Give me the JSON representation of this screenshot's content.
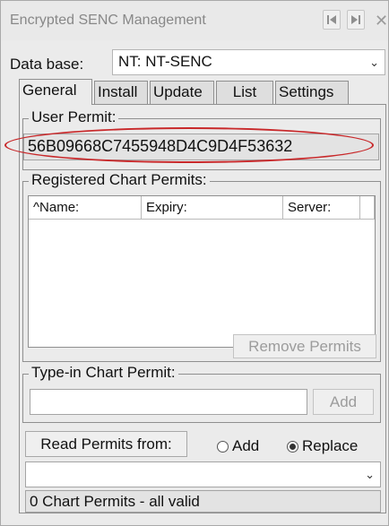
{
  "window": {
    "title": "Encrypted SENC Management"
  },
  "icons": {
    "prev": "skip-back-icon",
    "next": "skip-forward-icon",
    "close": "close-icon",
    "dropdown": "chevron-down-icon"
  },
  "database": {
    "label": "Data base:",
    "value": "NT: NT-SENC"
  },
  "tabs": [
    {
      "label": "General",
      "active": true
    },
    {
      "label": "Install",
      "active": false
    },
    {
      "label": "Update",
      "active": false
    },
    {
      "label": "List",
      "active": false
    },
    {
      "label": "Settings",
      "active": false
    }
  ],
  "user_permit": {
    "legend": "User Permit:",
    "value": "56B09668C7455948D4C9D4F53632",
    "highlight_color": "#c8282a"
  },
  "registered": {
    "legend": "Registered Chart Permits:",
    "columns": [
      "^Name:",
      "Expiry:",
      "Server:"
    ],
    "remove_label": "Remove Permits"
  },
  "typein": {
    "legend": "Type-in Chart Permit:",
    "value": "",
    "add_label": "Add"
  },
  "read": {
    "button_label": "Read Permits from:",
    "options": [
      {
        "label": "Add",
        "checked": false
      },
      {
        "label": "Replace",
        "checked": true
      }
    ],
    "source_value": ""
  },
  "status": "0 Chart Permits - all valid"
}
